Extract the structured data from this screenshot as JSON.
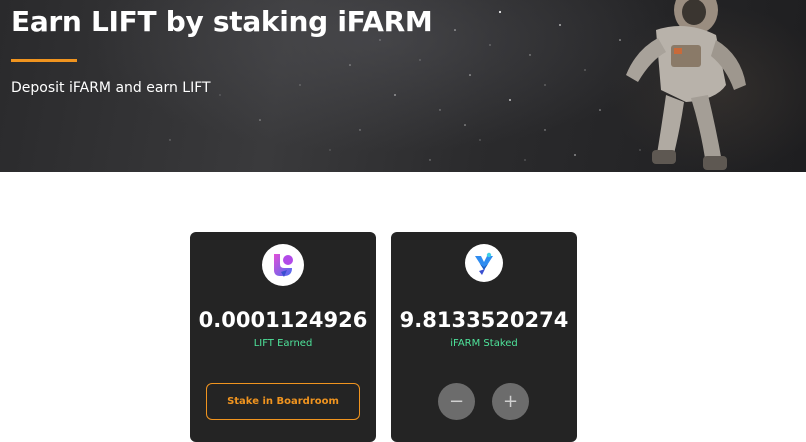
{
  "hero": {
    "title": "Earn LIFT by staking iFARM",
    "subtitle": "Deposit iFARM and earn LIFT"
  },
  "cards": {
    "earned": {
      "icon": "lift-token-icon",
      "amount": "0.0001124926",
      "label": "LIFT Earned",
      "button_label": "Stake in Boardroom"
    },
    "staked": {
      "icon": "ifarm-token-icon",
      "amount": "9.8133520274",
      "label": "iFARM Staked",
      "minus_label": "−",
      "plus_label": "+"
    }
  },
  "colors": {
    "accent": "#f0941f",
    "label_green": "#4ee39a",
    "card_bg": "#242424"
  }
}
